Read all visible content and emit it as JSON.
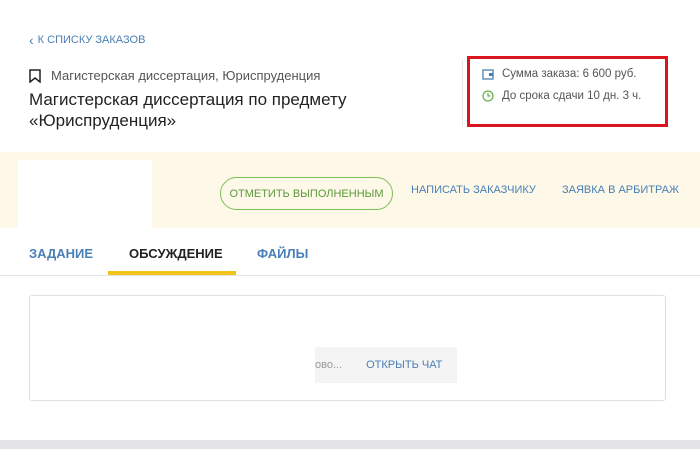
{
  "back_link": "К СПИСКУ ЗАКАЗОВ",
  "order": {
    "category": "Магистерская диссертация, Юриспруденция",
    "title": "Магистерская диссертация по предмету «Юриспруденция»",
    "sum": "Сумма заказа: 6 600 руб.",
    "deadline": "До срока сдачи 10 дн. 3 ч."
  },
  "actions": {
    "mark_done": "ОТМЕТИТЬ ВЫПОЛНЕННЫМ",
    "write_customer": "НАПИСАТЬ ЗАКАЗЧИКУ",
    "arbitration": "ЗАЯВКА В АРБИТРАЖ"
  },
  "tabs": [
    {
      "label": "ЗАДАНИЕ"
    },
    {
      "label": "ОБСУЖДЕНИЕ",
      "active": true
    },
    {
      "label": "ФАЙЛЫ"
    }
  ],
  "chat": {
    "preview": "ово...",
    "open_label": "ОТКРЫТЬ ЧАТ"
  },
  "colors": {
    "accent": "#4a7fb5",
    "highlight": "#d9141e",
    "tab_underline": "#f0c419",
    "success": "#5a9a3a"
  }
}
